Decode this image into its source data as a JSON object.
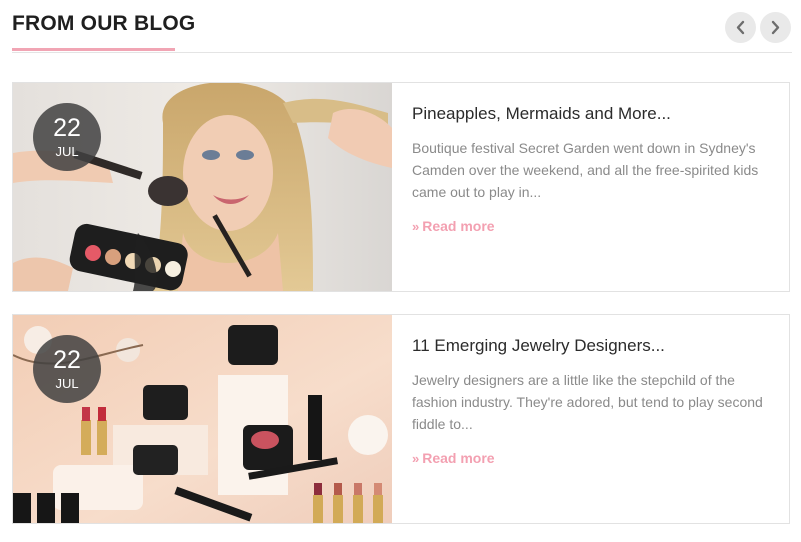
{
  "header": {
    "title": "FROM OUR BLOG"
  },
  "nav": {
    "prev_icon": "chevron-left-icon",
    "next_icon": "chevron-right-icon"
  },
  "colors": {
    "accent": "#f1a5b4",
    "badge": "#414141"
  },
  "posts": [
    {
      "date": {
        "day": "22",
        "month": "JUL"
      },
      "title": "Pineapples, Mermaids and More...",
      "excerpt": "Boutique festival Secret Garden went down in Sydney's Camden over the weekend, and all the free-spirited kids came out to play in...",
      "read_more": "Read more",
      "read_more_icon": "»"
    },
    {
      "date": {
        "day": "22",
        "month": "JUL"
      },
      "title": "11 Emerging Jewelry Designers...",
      "excerpt": "Jewelry designers are a little like the stepchild of the fashion industry. They're adored, but tend to play second fiddle to...",
      "read_more": "Read more",
      "read_more_icon": "»"
    }
  ]
}
